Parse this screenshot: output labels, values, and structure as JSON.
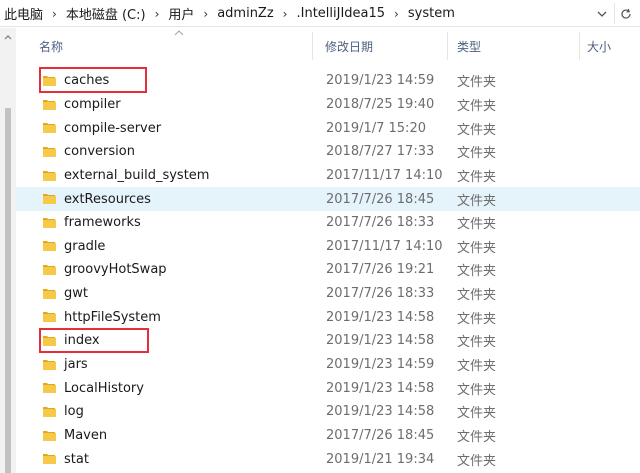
{
  "address_bar": {
    "crumbs": [
      "此电脑",
      "本地磁盘 (C:)",
      "用户",
      "adminZz",
      ".IntelliJIdea15",
      "system"
    ],
    "separator": "›",
    "dropdown_icon": "chevron-down-icon",
    "refresh_icon": "refresh-icon"
  },
  "columns": {
    "name": "名称",
    "date": "修改日期",
    "type": "类型",
    "size": "大小"
  },
  "rows": [
    {
      "name": "caches",
      "date": "2019/1/23 14:59",
      "type": "文件夹"
    },
    {
      "name": "compiler",
      "date": "2018/7/25 19:40",
      "type": "文件夹"
    },
    {
      "name": "compile-server",
      "date": "2019/1/7 15:20",
      "type": "文件夹"
    },
    {
      "name": "conversion",
      "date": "2018/7/27 17:33",
      "type": "文件夹"
    },
    {
      "name": "external_build_system",
      "date": "2017/11/17 14:10",
      "type": "文件夹"
    },
    {
      "name": "extResources",
      "date": "2017/7/26 18:45",
      "type": "文件夹"
    },
    {
      "name": "frameworks",
      "date": "2017/7/26 18:33",
      "type": "文件夹"
    },
    {
      "name": "gradle",
      "date": "2017/11/17 14:10",
      "type": "文件夹"
    },
    {
      "name": "groovyHotSwap",
      "date": "2017/7/26 19:21",
      "type": "文件夹"
    },
    {
      "name": "gwt",
      "date": "2017/7/26 18:33",
      "type": "文件夹"
    },
    {
      "name": "httpFileSystem",
      "date": "2019/1/23 14:58",
      "type": "文件夹"
    },
    {
      "name": "index",
      "date": "2019/1/23 14:58",
      "type": "文件夹"
    },
    {
      "name": "jars",
      "date": "2019/1/23 14:59",
      "type": "文件夹"
    },
    {
      "name": "LocalHistory",
      "date": "2019/1/23 14:58",
      "type": "文件夹"
    },
    {
      "name": "log",
      "date": "2019/1/23 14:58",
      "type": "文件夹"
    },
    {
      "name": "Maven",
      "date": "2017/7/26 18:45",
      "type": "文件夹"
    },
    {
      "name": "stat",
      "date": "2019/1/21 19:34",
      "type": "文件夹"
    }
  ],
  "hovered_row": "extResources",
  "highlighted_rows": [
    "caches",
    "index"
  ],
  "colors": {
    "folder": "#f7c948",
    "folder_dark": "#e2a81b",
    "highlight_box": "#e2303a",
    "hover_row": "#e5f3fb",
    "header_text": "#4d6082"
  }
}
